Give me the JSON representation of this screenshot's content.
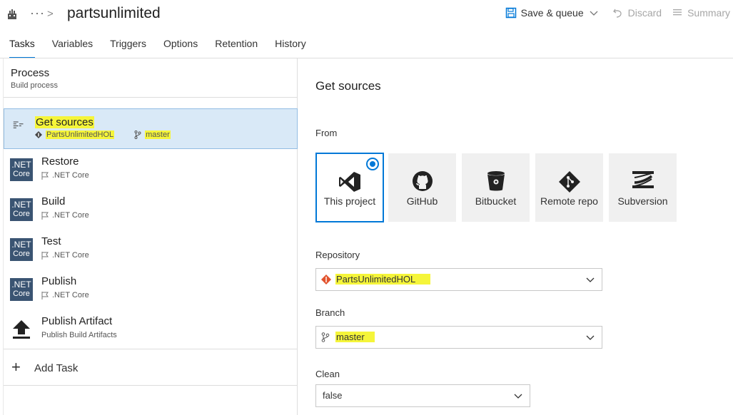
{
  "header": {
    "more": "···",
    "separator": ">",
    "title": "partsunlimited",
    "save_queue": "Save & queue",
    "discard": "Discard",
    "summary": "Summary"
  },
  "tabs": [
    {
      "label": "Tasks",
      "active": true
    },
    {
      "label": "Variables"
    },
    {
      "label": "Triggers"
    },
    {
      "label": "Options"
    },
    {
      "label": "Retention"
    },
    {
      "label": "History"
    }
  ],
  "process": {
    "title": "Process",
    "subtitle": "Build process"
  },
  "tasks": [
    {
      "title": "Get sources",
      "repo": "PartsUnlimitedHOL",
      "branch": "master",
      "selected": true
    },
    {
      "title": "Restore",
      "subtitle": ".NET Core",
      "icon": "net-core-icon",
      "icon_line1": ".NET",
      "icon_line2": "Core"
    },
    {
      "title": "Build",
      "subtitle": ".NET Core",
      "icon": "net-core-icon",
      "icon_line1": ".NET",
      "icon_line2": "Core"
    },
    {
      "title": "Test",
      "subtitle": ".NET Core",
      "icon": "net-core-icon",
      "icon_line1": ".NET",
      "icon_line2": "Core"
    },
    {
      "title": "Publish",
      "subtitle": ".NET Core",
      "icon": "net-core-icon",
      "icon_line1": ".NET",
      "icon_line2": "Core"
    },
    {
      "title": "Publish Artifact",
      "subtitle": "Publish Build Artifacts",
      "icon": "upload-icon"
    }
  ],
  "add_task": "Add Task",
  "detail": {
    "title": "Get sources",
    "from_label": "From",
    "sources": [
      {
        "label": "This project",
        "icon": "visual-studio-icon",
        "selected": true
      },
      {
        "label": "GitHub",
        "icon": "github-icon"
      },
      {
        "label": "Bitbucket",
        "icon": "bitbucket-icon"
      },
      {
        "label": "Remote repo",
        "icon": "git-icon"
      },
      {
        "label": "Subversion",
        "icon": "subversion-icon"
      }
    ],
    "repository_label": "Repository",
    "repository_value": "PartsUnlimitedHOL",
    "branch_label": "Branch",
    "branch_value": "master",
    "clean_label": "Clean",
    "clean_value": "false"
  },
  "colors": {
    "accent": "#0078d7",
    "highlight": "#f5f53a",
    "selected_bg": "#d9e9f7",
    "net_core": "#3a5472"
  }
}
